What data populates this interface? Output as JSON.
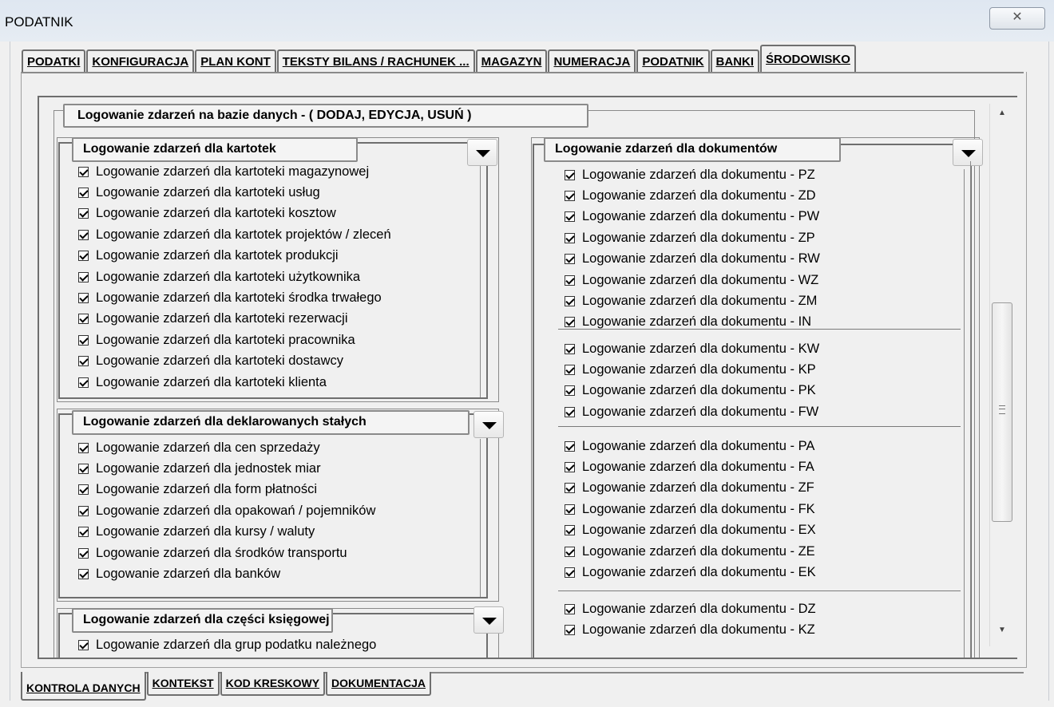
{
  "window": {
    "title": "PODATNIK",
    "close_label": "✕"
  },
  "top_tabs": [
    {
      "label": "PODATKI"
    },
    {
      "label": "KONFIGURACJA"
    },
    {
      "label": "PLAN KONT"
    },
    {
      "label": "TEKSTY BILANS / RACHUNEK ..."
    },
    {
      "label": "MAGAZYN"
    },
    {
      "label": "NUMERACJA"
    },
    {
      "label": "PODATNIK"
    },
    {
      "label": "BANKI"
    },
    {
      "label": "ŚRODOWISKO"
    }
  ],
  "active_top_tab": "ŚRODOWISKO",
  "main_group": {
    "title": "Logowanie zdarzeń na bazie danych  - ( DODAJ, EDYCJA, USUŃ )"
  },
  "groups": {
    "kartoteki": {
      "title": "Logowanie zdarzeń  dla kartotek",
      "items": [
        {
          "label": "Logowanie zdarzeń dla kartoteki magazynowej",
          "checked": true
        },
        {
          "label": "Logowanie zdarzeń dla kartoteki usług",
          "checked": true
        },
        {
          "label": "Logowanie zdarzeń dla kartoteki kosztow",
          "checked": true
        },
        {
          "label": "Logowanie zdarzeń dla kartotek projektów / zleceń",
          "checked": true
        },
        {
          "label": "Logowanie zdarzeń dla kartotek produkcji",
          "checked": true
        },
        {
          "label": "Logowanie zdarzeń dla  kartoteki użytkownika",
          "checked": true
        },
        {
          "label": "Logowanie zdarzeń dla  kartoteki środka trwałego",
          "checked": true
        },
        {
          "label": "Logowanie zdarzeń dla  kartoteki rezerwacji",
          "checked": true
        },
        {
          "label": "Logowanie zdarzeń dla kartoteki  pracownika",
          "checked": true
        },
        {
          "label": "Logowanie zdarzeń dla kartoteki dostawcy",
          "checked": true
        },
        {
          "label": "Logowanie zdarzeń dla kartoteki  klienta",
          "checked": true
        }
      ]
    },
    "stale": {
      "title": "Logowanie zdarzeń  dla  deklarowanych stałych",
      "items": [
        {
          "label": "Logowanie zdarzeń dla cen sprzedaży",
          "checked": true
        },
        {
          "label": "Logowanie zdarzeń dla jednostek miar",
          "checked": true
        },
        {
          "label": "Logowanie zdarzeń dla form płatności",
          "checked": true
        },
        {
          "label": "Logowanie zdarzeń dla  opakowań / pojemników",
          "checked": true
        },
        {
          "label": "Logowanie zdarzeń dla  kursy / waluty",
          "checked": true
        },
        {
          "label": "Logowanie zdarzeń dla  środków transportu",
          "checked": true
        },
        {
          "label": "Logowanie zdarzeń dla  banków",
          "checked": true
        }
      ]
    },
    "ksiegowe": {
      "title": "Logowanie zdarzeń  dla części księgowej",
      "items": [
        {
          "label": "Logowanie zdarzeń dla grup podatku należnego",
          "checked": true
        }
      ]
    },
    "dokumenty": {
      "title": "Logowanie zdarzeń  dla  dokumentów",
      "sections": [
        [
          {
            "label": "Logowanie zdarzeń dla dokumentu - PZ",
            "checked": true
          },
          {
            "label": "Logowanie zdarzeń dla dokumentu - ZD",
            "checked": true
          },
          {
            "label": "Logowanie zdarzeń dla dokumentu - PW",
            "checked": true
          },
          {
            "label": "Logowanie zdarzeń dla dokumentu - ZP",
            "checked": true
          },
          {
            "label": "Logowanie zdarzeń dla dokumentu - RW",
            "checked": true
          },
          {
            "label": "Logowanie zdarzeń dla dokumentu - WZ",
            "checked": true
          },
          {
            "label": "Logowanie zdarzeń dla dokumentu - ZM",
            "checked": true
          },
          {
            "label": "Logowanie zdarzeń dla dokumentu - IN",
            "checked": true
          }
        ],
        [
          {
            "label": "Logowanie zdarzeń dla dokumentu - KW",
            "checked": true
          },
          {
            "label": "Logowanie zdarzeń dla dokumentu - KP",
            "checked": true
          },
          {
            "label": "Logowanie zdarzeń dla dokumentu - PK",
            "checked": true
          },
          {
            "label": "Logowanie zdarzeń dla dokumentu - FW",
            "checked": true
          }
        ],
        [
          {
            "label": "Logowanie zdarzeń dla dokumentu - PA",
            "checked": true
          },
          {
            "label": "Logowanie zdarzeń dla dokumentu - FA",
            "checked": true
          },
          {
            "label": "Logowanie zdarzeń dla dokumentu - ZF",
            "checked": true
          },
          {
            "label": "Logowanie zdarzeń dla dokumentu - FK",
            "checked": true
          },
          {
            "label": "Logowanie zdarzeń dla dokumentu - EX",
            "checked": true
          },
          {
            "label": "Logowanie zdarzeń dla dokumentu - ZE",
            "checked": true
          },
          {
            "label": "Logowanie zdarzeń dla dokumentu - EK",
            "checked": true
          }
        ],
        [
          {
            "label": "Logowanie zdarzeń dla dokumentu - DZ",
            "checked": true
          },
          {
            "label": "Logowanie zdarzeń dla dokumentu - KZ",
            "checked": true
          }
        ]
      ]
    }
  },
  "bottom_tabs": [
    {
      "label": "KONTROLA DANYCH"
    },
    {
      "label": "KONTEKST"
    },
    {
      "label": "KOD KRESKOWY"
    },
    {
      "label": "DOKUMENTACJA"
    }
  ],
  "active_bottom_tab": "KONTROLA DANYCH",
  "icons": {
    "dropdown": "chevron-down-icon",
    "close": "close-icon",
    "scroll_up": "scroll-up-arrow-icon",
    "scroll_down": "scroll-down-arrow-icon",
    "checkbox": "checkbox-checked-icon"
  }
}
